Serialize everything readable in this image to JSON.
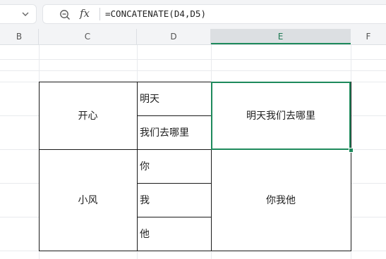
{
  "formula_bar": {
    "zoom_icon": "zoom-out-icon",
    "fx_label": "fx",
    "formula": "=CONCATENATE(D4,D5)"
  },
  "columns": [
    "B",
    "C",
    "D",
    "E",
    "F"
  ],
  "selected_column": "E",
  "cells": {
    "C_merged_1": "开心",
    "D4": "明天",
    "D5": "我们去哪里",
    "E_merged_1": "明天我们去哪里",
    "C_merged_2": "小风",
    "D6": "你",
    "D7": "我",
    "D8": "他",
    "E_merged_2": "你我他"
  },
  "colors": {
    "selection": "#1e8a5c",
    "header_bg": "#f3f4f6",
    "grid": "#e8eaed"
  }
}
